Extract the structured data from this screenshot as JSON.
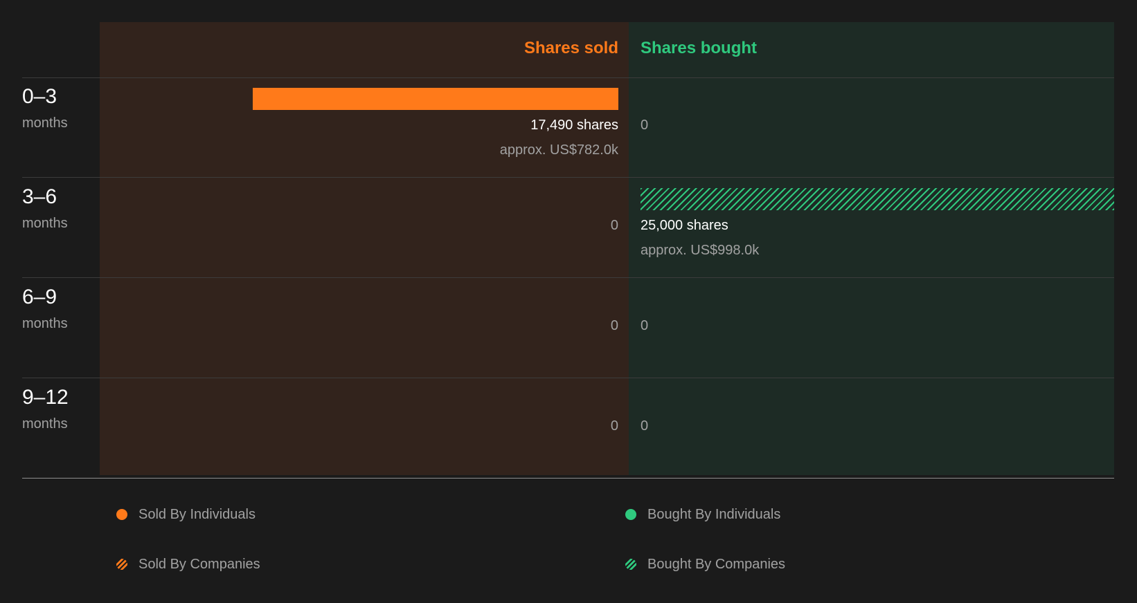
{
  "colors": {
    "sold": "#ff7a1a",
    "bought": "#2fc97e"
  },
  "chart_data": {
    "type": "bar",
    "headers": {
      "sold": "Shares sold",
      "bought": "Shares bought"
    },
    "max_shares": 25000,
    "rows": [
      {
        "period": "0–3",
        "unit": "months",
        "sold": {
          "shares": 17490,
          "shares_label": "17,490 shares",
          "value_label": "approx. US$782.0k",
          "type": "individuals"
        },
        "bought": {
          "shares": 0,
          "shares_label": "0"
        }
      },
      {
        "period": "3–6",
        "unit": "months",
        "sold": {
          "shares": 0,
          "shares_label": "0"
        },
        "bought": {
          "shares": 25000,
          "shares_label": "25,000 shares",
          "value_label": "approx. US$998.0k",
          "type": "companies"
        }
      },
      {
        "period": "6–9",
        "unit": "months",
        "sold": {
          "shares": 0,
          "shares_label": "0"
        },
        "bought": {
          "shares": 0,
          "shares_label": "0"
        }
      },
      {
        "period": "9–12",
        "unit": "months",
        "sold": {
          "shares": 0,
          "shares_label": "0"
        },
        "bought": {
          "shares": 0,
          "shares_label": "0"
        }
      }
    ],
    "legend": [
      {
        "label": "Sold By Individuals",
        "side": "sold",
        "pattern": "solid"
      },
      {
        "label": "Bought By Individuals",
        "side": "bought",
        "pattern": "solid"
      },
      {
        "label": "Sold By Companies",
        "side": "sold",
        "pattern": "striped"
      },
      {
        "label": "Bought By Companies",
        "side": "bought",
        "pattern": "striped"
      }
    ]
  }
}
